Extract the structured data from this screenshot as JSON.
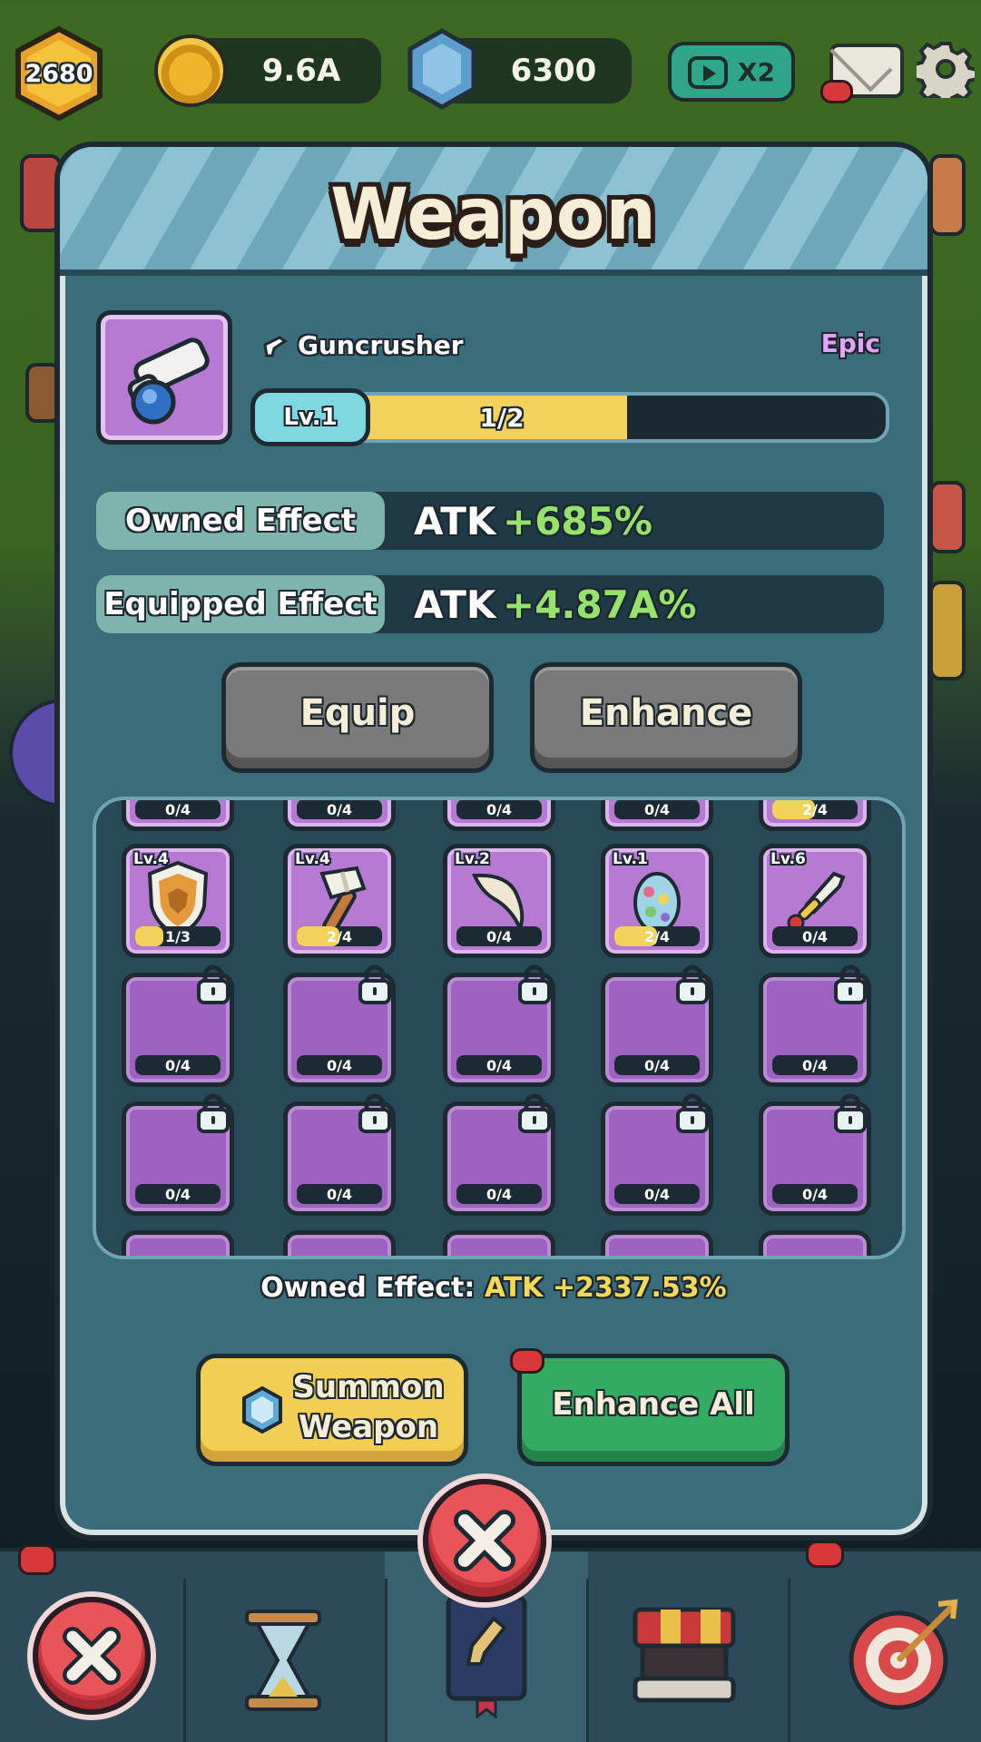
{
  "hud": {
    "player_level": "2680",
    "gold": "9.6A",
    "gems": "6300",
    "speed_multiplier": "X2"
  },
  "panel": {
    "title": "Weapon",
    "item": {
      "name": "Guncrusher",
      "rarity": "Epic",
      "level": "Lv.1",
      "progress_text": "1/2",
      "progress_fraction": 0.5
    },
    "owned_effect": {
      "label": "Owned Effect",
      "stat": "ATK",
      "value": "+685%"
    },
    "equipped_effect": {
      "label": "Equipped Effect",
      "stat": "ATK",
      "value": "+4.87A%"
    },
    "equip_label": "Equip",
    "enhance_label": "Enhance",
    "grid": {
      "top_partial": [
        {
          "count": "0/4",
          "fill": 0
        },
        {
          "count": "0/4",
          "fill": 0
        },
        {
          "count": "0/4",
          "fill": 0
        },
        {
          "count": "0/4",
          "fill": 0
        },
        {
          "count": "2/4",
          "fill": 0.5
        }
      ],
      "items": [
        {
          "level": "Lv.4",
          "count": "1/3",
          "fill": 0.33,
          "icon": "shield-icon"
        },
        {
          "level": "Lv.4",
          "count": "2/4",
          "fill": 0.5,
          "icon": "hammer-icon"
        },
        {
          "level": "Lv.2",
          "count": "0/4",
          "fill": 0,
          "icon": "boomerang-icon"
        },
        {
          "level": "Lv.1",
          "count": "2/4",
          "fill": 0.5,
          "icon": "egg-icon"
        },
        {
          "level": "Lv.6",
          "count": "0/4",
          "fill": 0,
          "icon": "dagger-icon"
        }
      ],
      "locked_row_1": [
        "0/4",
        "0/4",
        "0/4",
        "0/4",
        "0/4"
      ],
      "locked_row_2": [
        "0/4",
        "0/4",
        "0/4",
        "0/4",
        "0/4"
      ]
    },
    "summary": {
      "label": "Owned Effect:",
      "stat": "ATK",
      "value": "+2337.53%"
    },
    "summon_label_line1": "Summon",
    "summon_label_line2": "Weapon",
    "enhance_all_label": "Enhance All"
  },
  "colors": {
    "panel_bg": "#3b6c7a",
    "epic_purple": "#b77ad3",
    "effect_green": "#97e26b",
    "highlight_yellow": "#f4d959",
    "summon_yellow": "#f2cf52",
    "enhance_green": "#34ab62",
    "close_red": "#e9545a"
  }
}
